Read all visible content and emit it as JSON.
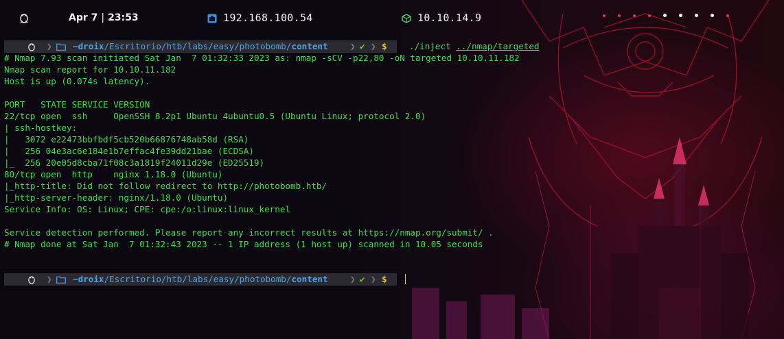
{
  "topbar": {
    "date": "Apr 7",
    "separator": "|",
    "time": "23:53",
    "local_ip": "192.168.100.54",
    "vpn_ip": "10.10.14.9",
    "icons": {
      "os": "tux-penguin-icon",
      "network": "ethernet-icon",
      "vpn": "cube-icon"
    },
    "workspaces": [
      "red",
      "red",
      "red",
      "red",
      "white",
      "white",
      "white",
      "white",
      "red"
    ]
  },
  "prompt": {
    "os_icon": "tux-penguin-icon",
    "folder_icon": "folder-icon",
    "home": "~",
    "user": "droix",
    "path": "/Escritorio/htb/labs/easy/photobomb/",
    "cwd": "content",
    "status": "✔",
    "symbol": "$"
  },
  "command": {
    "prefix": "./inject ",
    "arg": "../nmap/targeted"
  },
  "output": [
    "# Nmap 7.93 scan initiated Sat Jan  7 01:32:33 2023 as: nmap -sCV -p22,80 -oN targeted 10.10.11.182",
    "Nmap scan report for 10.10.11.182",
    "Host is up (0.074s latency).",
    "",
    "PORT   STATE SERVICE VERSION",
    "22/tcp open  ssh     OpenSSH 8.2p1 Ubuntu 4ubuntu0.5 (Ubuntu Linux; protocol 2.0)",
    "| ssh-hostkey: ",
    "|   3072 e22473bbfbdf5cb520b66876748ab58d (RSA)",
    "|   256 04e3ac6e184e1b7effac4fe39dd21bae (ECDSA)",
    "|_  256 20e05d8cba71f08c3a1819f24011d29e (ED25519)",
    "80/tcp open  http    nginx 1.18.0 (Ubuntu)",
    "|_http-title: Did not follow redirect to http://photobomb.htb/",
    "|_http-server-header: nginx/1.18.0 (Ubuntu)",
    "Service Info: OS: Linux; CPE: cpe:/o:linux:linux_kernel",
    "",
    "Service detection performed. Please report any incorrect results at https://nmap.org/submit/ .",
    "# Nmap done at Sat Jan  7 01:32:43 2023 -- 1 IP address (1 host up) scanned in 10.05 seconds"
  ],
  "colors": {
    "terminal_text": "#39e24a",
    "directory": "#4fa3e6",
    "ok": "#7bd02b",
    "dollar": "#e8c44c",
    "workspace_inactive": "#e0304f",
    "workspace_active": "#ffffff"
  }
}
